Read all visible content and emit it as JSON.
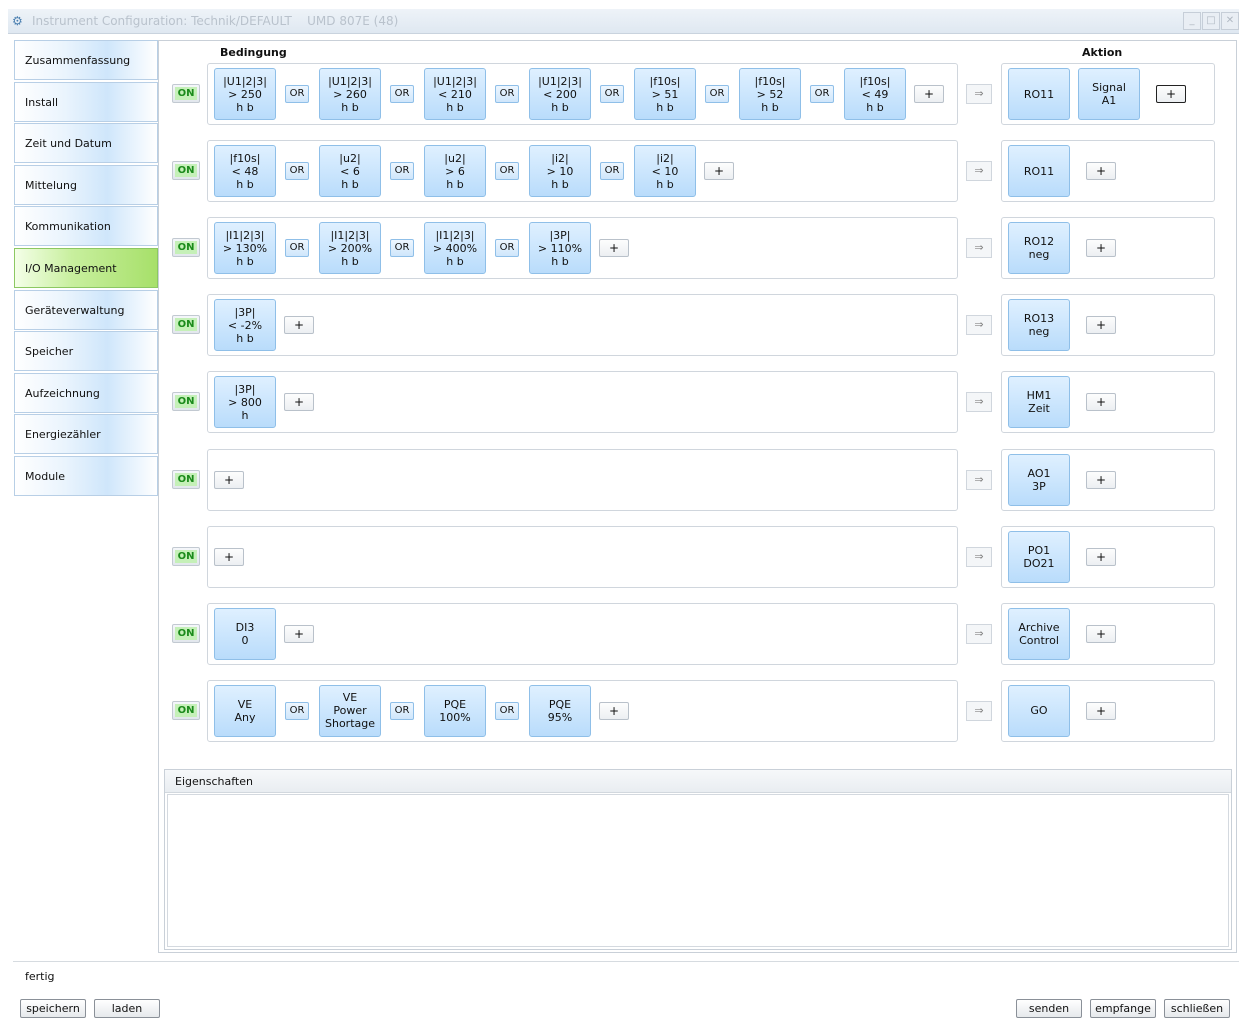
{
  "window": {
    "title": "Instrument Configuration: Technik/DEFAULT",
    "device": "UMD 807E (48)"
  },
  "sidebar": {
    "items": [
      {
        "label": "Zusammenfassung"
      },
      {
        "label": "Install"
      },
      {
        "label": "Zeit und Datum"
      },
      {
        "label": "Mittelung"
      },
      {
        "label": "Kommunikation"
      },
      {
        "label": "I/O Management",
        "active": true
      },
      {
        "label": "Geräteverwaltung"
      },
      {
        "label": "Speicher"
      },
      {
        "label": "Aufzeichnung"
      },
      {
        "label": "Energiezähler"
      },
      {
        "label": "Module"
      }
    ]
  },
  "headers": {
    "condition": "Bedingung",
    "action": "Aktion"
  },
  "labels": {
    "on": "ON",
    "or": "OR",
    "plus": "+",
    "arrow": "⇒"
  },
  "rules": [
    {
      "conditions": [
        [
          "|U1|2|3|",
          "> 250",
          "h b"
        ],
        [
          "|U1|2|3|",
          "> 260",
          "h b"
        ],
        [
          "|U1|2|3|",
          "< 210",
          "h b"
        ],
        [
          "|U1|2|3|",
          "< 200",
          "h b"
        ],
        [
          "|f10s|",
          "> 51",
          "h b"
        ],
        [
          "|f10s|",
          "> 52",
          "h b"
        ],
        [
          "|f10s|",
          "< 49",
          "h b"
        ]
      ],
      "actions": [
        [
          "RO11"
        ],
        [
          "Signal",
          "A1"
        ]
      ]
    },
    {
      "conditions": [
        [
          "|f10s|",
          "< 48",
          "h b"
        ],
        [
          "|u2|",
          "< 6",
          "h b"
        ],
        [
          "|u2|",
          "> 6",
          "h b"
        ],
        [
          "|i2|",
          "> 10",
          "h b"
        ],
        [
          "|i2|",
          "< 10",
          "h b"
        ]
      ],
      "actions": [
        [
          "RO11"
        ]
      ]
    },
    {
      "conditions": [
        [
          "|I1|2|3|",
          "> 130%",
          "h b"
        ],
        [
          "|I1|2|3|",
          "> 200%",
          "h b"
        ],
        [
          "|I1|2|3|",
          "> 400%",
          "h b"
        ],
        [
          "|3P|",
          "> 110%",
          "h b"
        ]
      ],
      "actions": [
        [
          "RO12",
          "neg"
        ]
      ]
    },
    {
      "conditions": [
        [
          "|3P|",
          "< -2%",
          "h b"
        ]
      ],
      "actions": [
        [
          "RO13",
          "neg"
        ]
      ]
    },
    {
      "conditions": [
        [
          "|3P|",
          "> 800",
          "h"
        ]
      ],
      "actions": [
        [
          "HM1",
          "Zeit"
        ]
      ]
    },
    {
      "conditions": [],
      "actions": [
        [
          "AO1",
          "3P"
        ]
      ]
    },
    {
      "conditions": [],
      "actions": [
        [
          "PO1",
          "DO21"
        ]
      ]
    },
    {
      "conditions": [
        [
          "DI3",
          "0"
        ]
      ],
      "actions": [
        [
          "Archive",
          "Control"
        ]
      ]
    },
    {
      "conditions": [
        [
          "VE",
          "Any"
        ],
        [
          "VE",
          "Power",
          "Shortage"
        ],
        [
          "PQE",
          "100%"
        ],
        [
          "PQE",
          "95%"
        ]
      ],
      "actions": [
        [
          "GO"
        ]
      ]
    }
  ],
  "properties": {
    "title": "Eigenschaften"
  },
  "status": {
    "text": "fertig"
  },
  "buttons": {
    "save": "speichern",
    "load": "laden",
    "send": "senden",
    "receive": "empfange",
    "close": "schließen"
  },
  "colors": {
    "active_tab": "#a7e06a",
    "on_text": "#1a8a1a",
    "tile": "#b9dcfb"
  }
}
